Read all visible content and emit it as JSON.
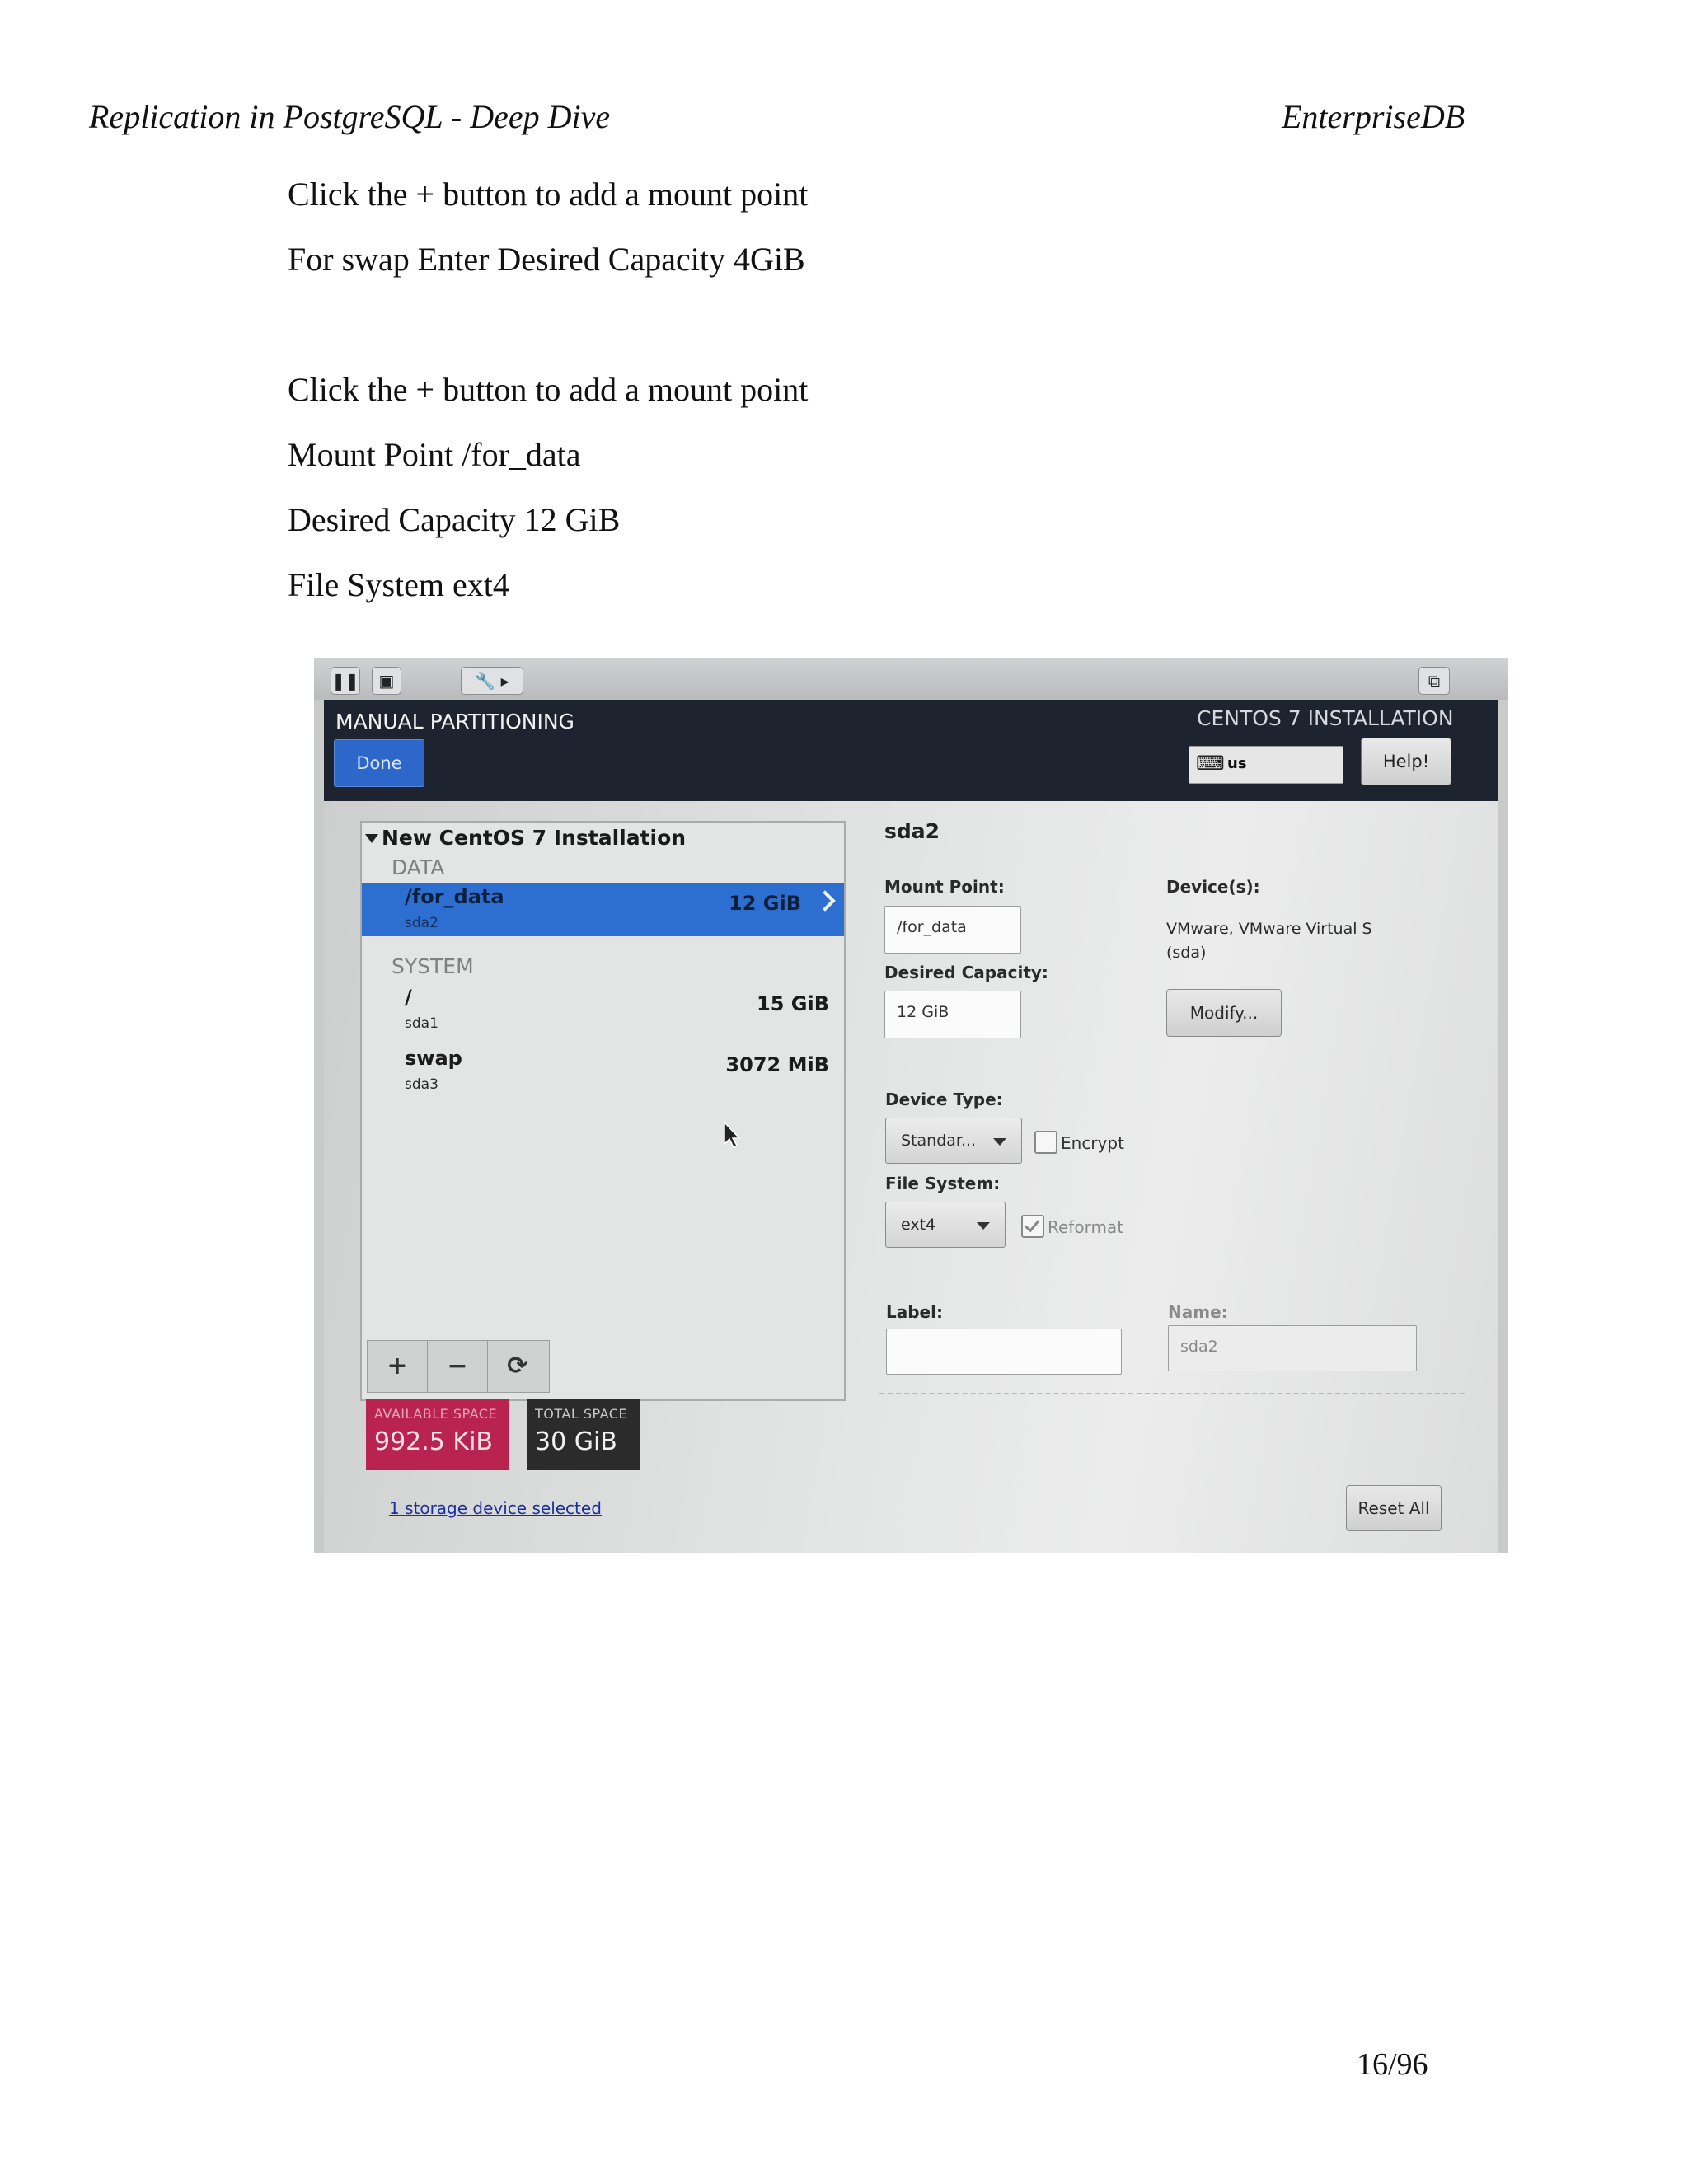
{
  "header": {
    "left": "Replication in PostgreSQL - Deep Dive",
    "right": "EnterpriseDB"
  },
  "instructions": [
    "Click the + button to add a mount point",
    "For swap Enter Desired Capacity 4GiB",
    "Click the + button to add a mount point",
    "Mount Point /for_data",
    "Desired Capacity 12 GiB",
    "File System ext4"
  ],
  "screenshot": {
    "title": "MANUAL PARTITIONING",
    "product": "CENTOS 7 INSTALLATION",
    "done_label": "Done",
    "keyboard_layout": "us",
    "help_label": "Help!",
    "install_tree": {
      "title": "New CentOS 7 Installation",
      "sections": [
        {
          "name": "DATA",
          "items": [
            {
              "mount": "/for_data",
              "device": "sda2",
              "size": "12 GiB",
              "selected": true
            }
          ]
        },
        {
          "name": "SYSTEM",
          "items": [
            {
              "mount": "/",
              "device": "sda1",
              "size": "15 GiB",
              "selected": false
            },
            {
              "mount": "swap",
              "device": "sda3",
              "size": "3072 MiB",
              "selected": false
            }
          ]
        }
      ]
    },
    "buttons": {
      "add": "+",
      "remove": "−",
      "refresh": "⟳",
      "modify": "Modify...",
      "reset_all": "Reset All"
    },
    "available_space": {
      "label": "AVAILABLE SPACE",
      "value": "992.5 KiB",
      "color": "#b8244f"
    },
    "total_space": {
      "label": "TOTAL SPACE",
      "value": "30 GiB",
      "color": "#2b2b2b"
    },
    "storage_link": "1 storage device selected",
    "detail": {
      "title": "sda2",
      "mount_point_label": "Mount Point:",
      "mount_point_value": "/for_data",
      "desired_capacity_label": "Desired Capacity:",
      "desired_capacity_value": "12 GiB",
      "devices_label": "Device(s):",
      "devices_value": "VMware, VMware Virtual S (sda)",
      "device_type_label": "Device Type:",
      "device_type_value": "Standar...",
      "encrypt_label": "Encrypt",
      "encrypt_checked": false,
      "file_system_label": "File System:",
      "file_system_value": "ext4",
      "reformat_label": "Reformat",
      "reformat_checked": true,
      "label_label": "Label:",
      "label_value": "",
      "name_label": "Name:",
      "name_value": "sda2"
    }
  },
  "page_number": "16/96"
}
